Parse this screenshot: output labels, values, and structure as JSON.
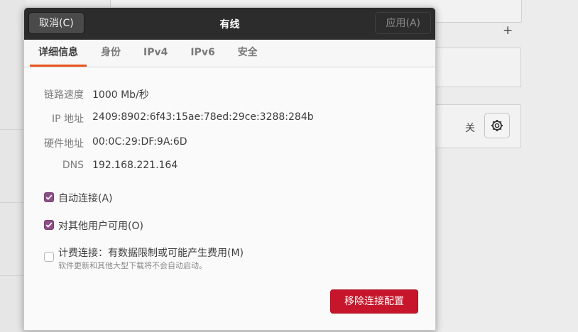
{
  "dialog": {
    "title": "有线",
    "cancel_label": "取消(C)",
    "apply_label": "应用(A)"
  },
  "tabs": [
    {
      "label": "详细信息"
    },
    {
      "label": "身份"
    },
    {
      "label": "IPv4"
    },
    {
      "label": "IPv6"
    },
    {
      "label": "安全"
    }
  ],
  "details": [
    {
      "label": "链路速度",
      "value": "1000 Mb/秒"
    },
    {
      "label": "IP 地址",
      "value": "2409:8902:6f43:15ae:78ed:29ce:3288:284b"
    },
    {
      "label": "硬件地址",
      "value": "00:0C:29:DF:9A:6D"
    },
    {
      "label": "DNS",
      "value": "192.168.221.164"
    }
  ],
  "options": {
    "auto_connect": {
      "label": "自动连接(A)",
      "checked": true
    },
    "all_users": {
      "label": "对其他用户可用(O)",
      "checked": true
    },
    "metered": {
      "label": "计费连接：有数据限制或可能产生费用(M)",
      "sublabel": "软件更新和其他大型下载将不会自动启动。",
      "checked": false
    }
  },
  "remove_label": "移除连接配置",
  "background": {
    "plus_label": "+",
    "off_label": "关"
  },
  "colors": {
    "headerbar": "#2c2c2c",
    "accent": "#e95420",
    "checkbox": "#8b4f86",
    "destructive": "#c7162b"
  }
}
